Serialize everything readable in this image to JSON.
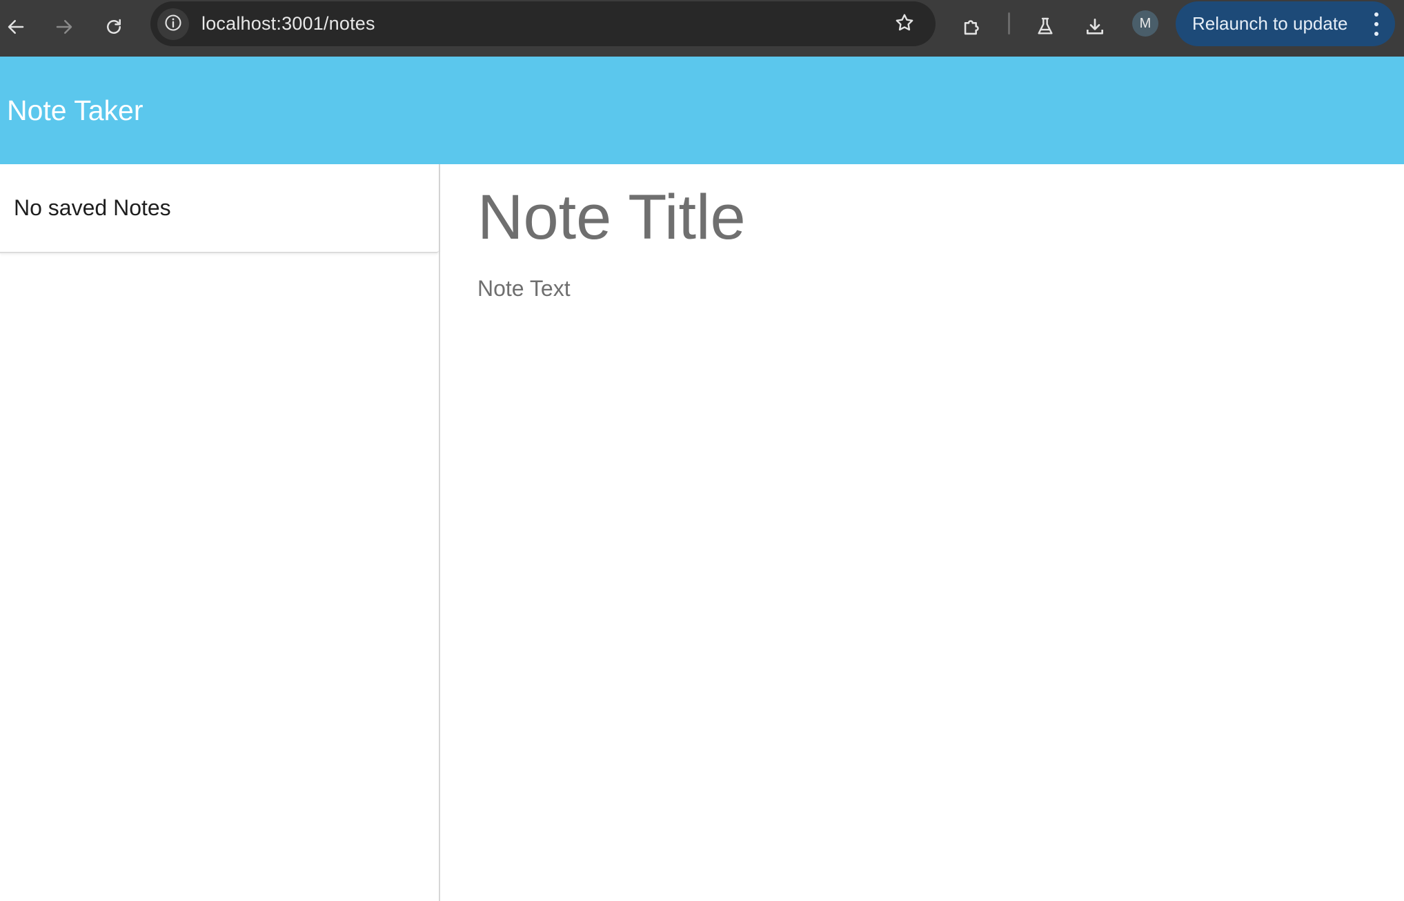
{
  "browser": {
    "url": "localhost:3001/notes",
    "profile_initial": "M",
    "relaunch_label": "Relaunch to update",
    "icons": [
      "back-arrow-icon",
      "forward-arrow-icon",
      "reload-icon",
      "site-info-icon",
      "bookmark-star-icon",
      "extensions-puzzle-icon",
      "labs-flask-icon",
      "downloads-icon",
      "kebab-menu-icon"
    ],
    "colors": {
      "chrome_bg": "#3c3c3c",
      "omnibox_bg": "#282828",
      "relaunch_bg": "#1d4a78"
    }
  },
  "app": {
    "brand": "Note Taker",
    "colors": {
      "navbar_bg": "#5bc7ed",
      "placeholder_text": "#6f6f6f"
    },
    "sidebar": {
      "empty_message": "No saved Notes"
    },
    "editor": {
      "title_placeholder": "Note Title",
      "text_placeholder": "Note Text",
      "title_value": "",
      "text_value": ""
    }
  }
}
